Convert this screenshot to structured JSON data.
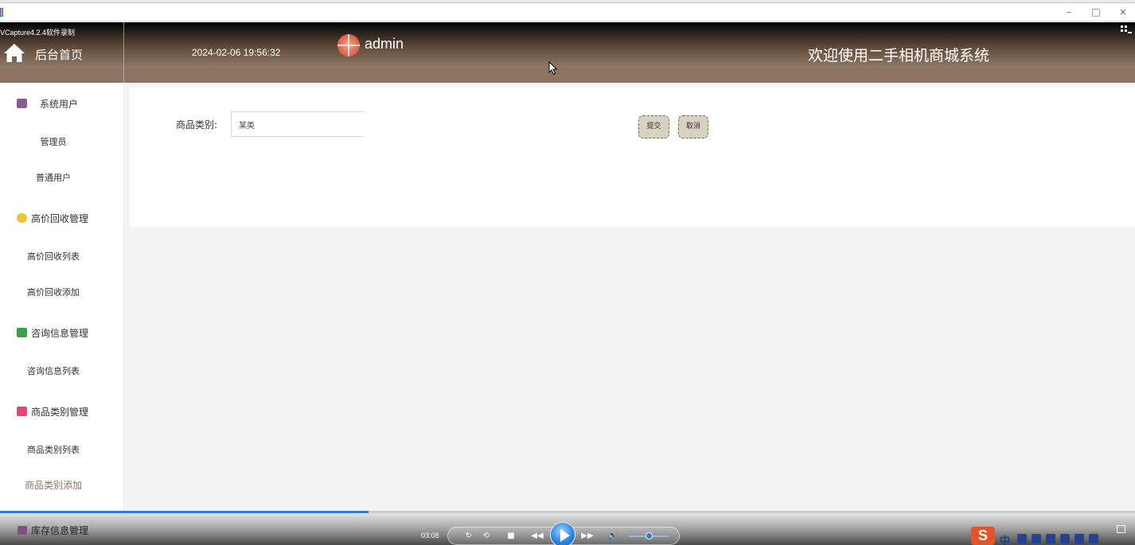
{
  "recorder": {
    "watermark": "VCapture4.2.4软件录制"
  },
  "window": {
    "minimize_glyph": "–",
    "maximize_glyph": "□",
    "close_glyph": "×"
  },
  "header": {
    "home_label": "后台首页",
    "datetime": "2024-02-06 19:56:32",
    "username": "admin",
    "welcome": "欢迎使用二手相机商城系统",
    "colors": {
      "gradient_top": "#000000",
      "gradient_bottom": "#8b7360"
    }
  },
  "sidebar": {
    "groups": [
      {
        "label": "系统用户",
        "icon": "user-group-icon",
        "color": "#8b5c93",
        "items": [
          "管理员",
          "普通用户"
        ]
      },
      {
        "label": "高价回收管理",
        "icon": "hexagon-icon",
        "color": "#f2c230",
        "items": [
          "高价回收列表",
          "高价回收添加"
        ]
      },
      {
        "label": "咨询信息管理",
        "icon": "chat-bubble-icon",
        "color": "#3aa04a",
        "items": [
          "咨询信息列表"
        ]
      },
      {
        "label": "商品类别管理",
        "icon": "tag-icon",
        "color": "#e0457b",
        "items": [
          "商品类别列表",
          "商品类别添加"
        ]
      },
      {
        "label": "库存信息管理",
        "icon": "user-group-icon",
        "color": "#7e4f86",
        "items": []
      }
    ],
    "active_item": "商品类别添加"
  },
  "form": {
    "category_label": "商品类别:",
    "category_value": "某类",
    "submit_label": "提交",
    "cancel_label": "取消"
  },
  "player": {
    "time": "03:08",
    "progress": 0.325,
    "volume": 0.5,
    "tray_logo": "S",
    "ime_label": "中"
  }
}
